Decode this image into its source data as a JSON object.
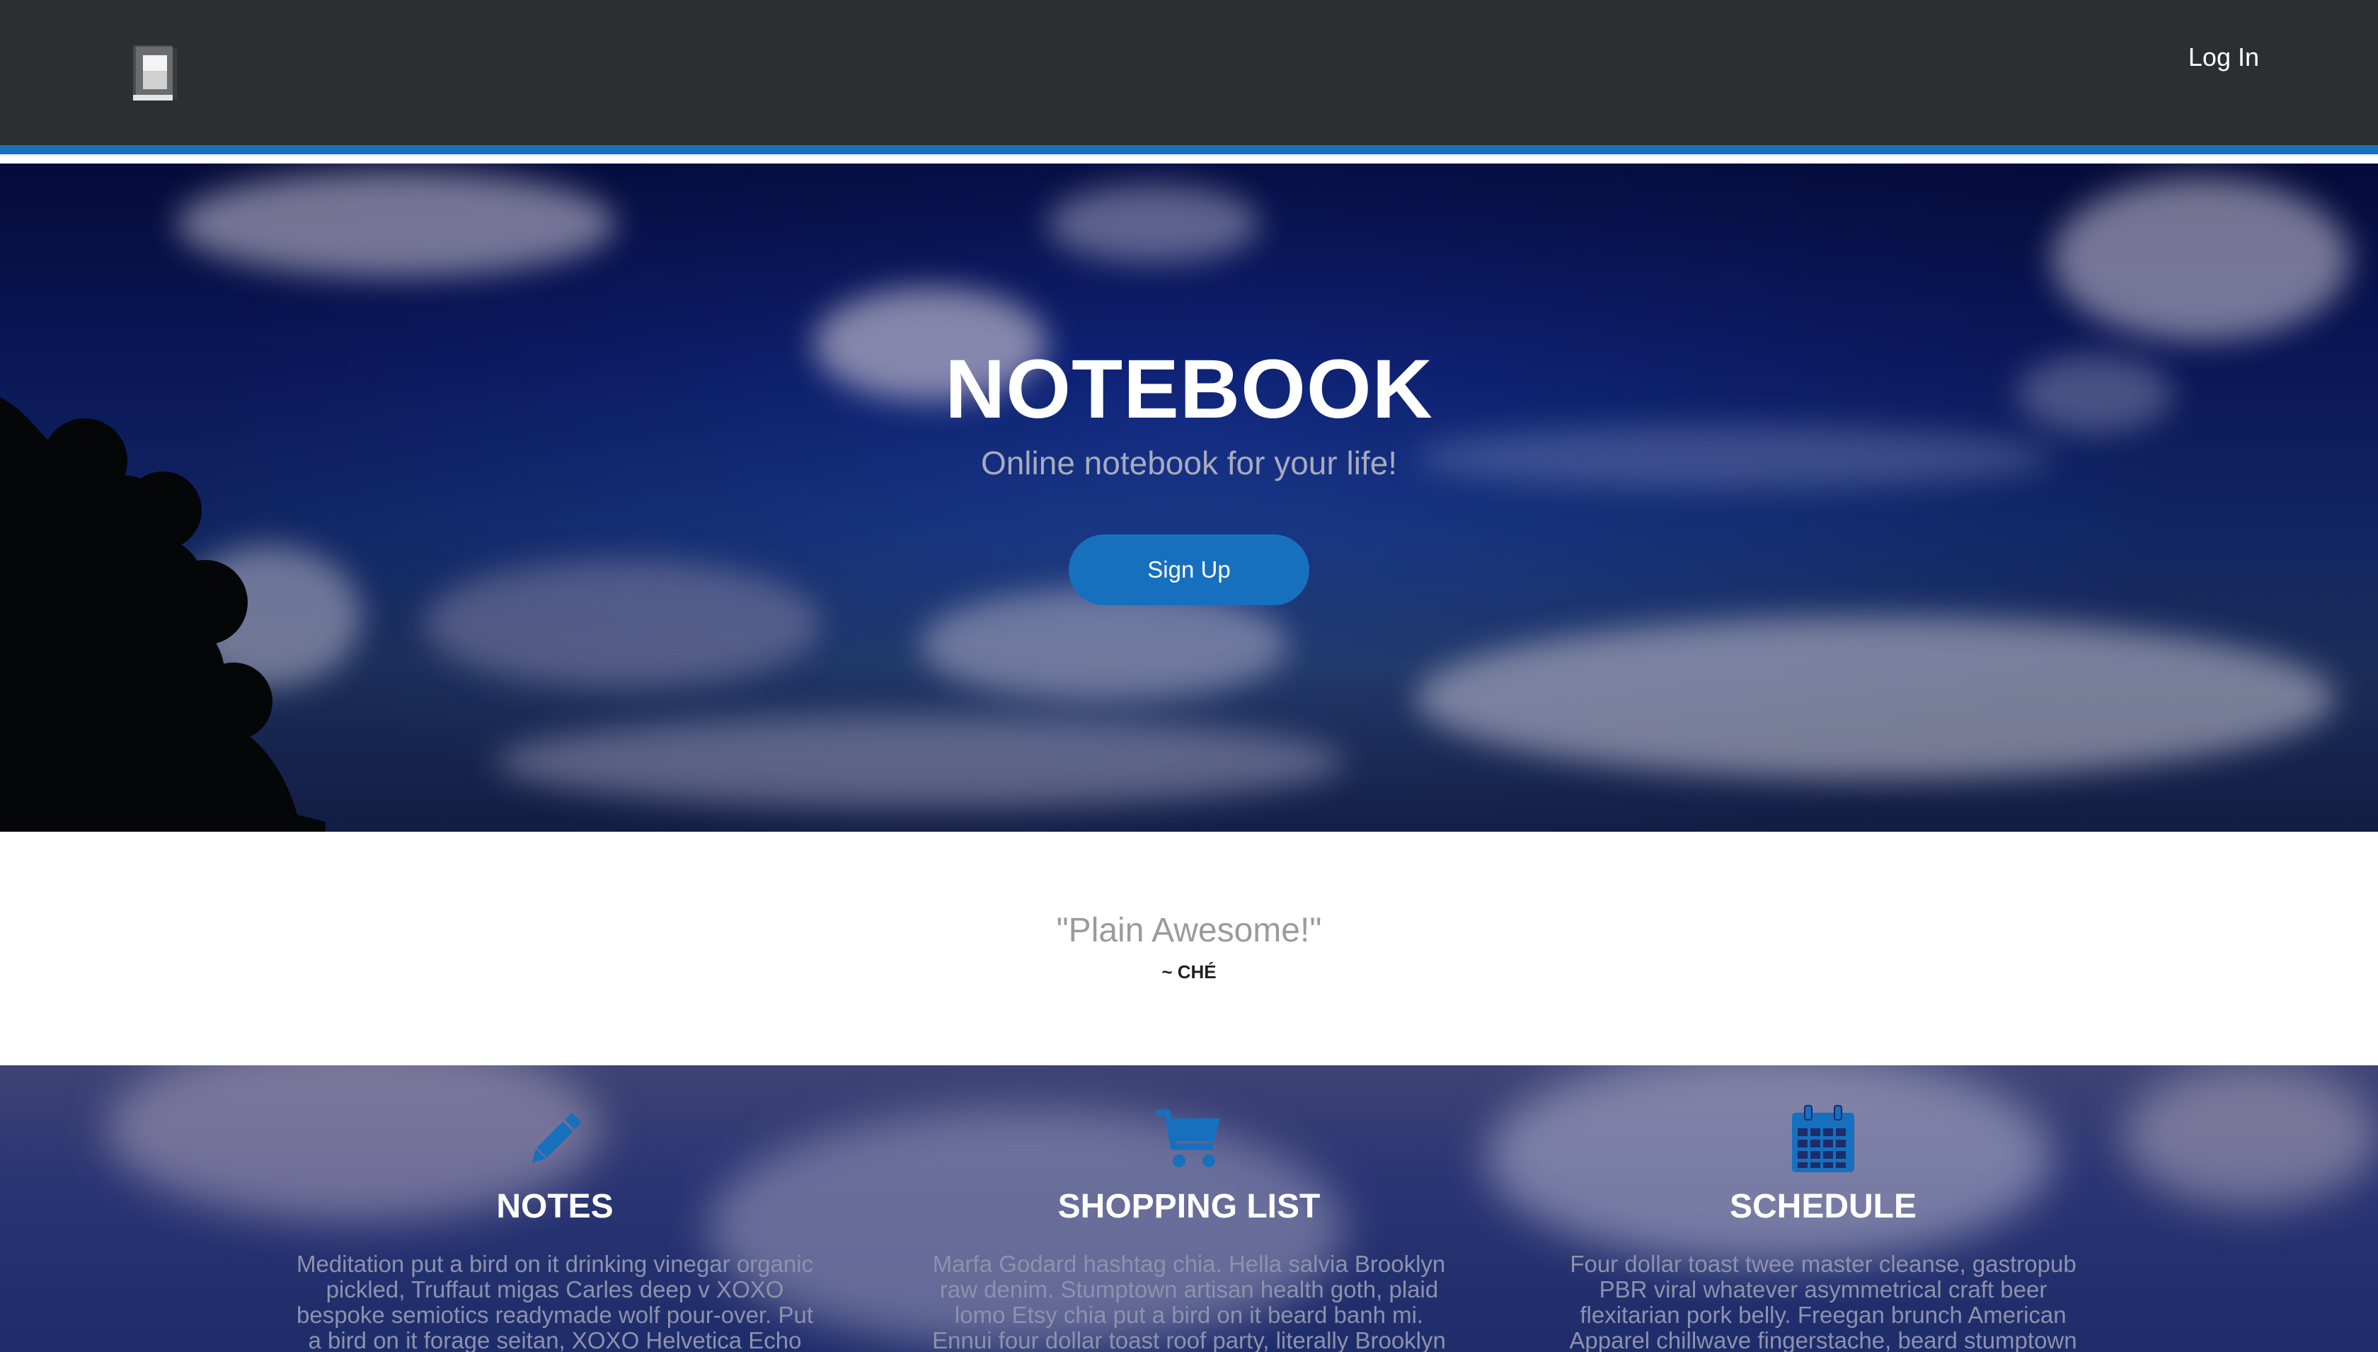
{
  "navbar": {
    "logo_icon": "notebook-icon",
    "login_label": "Log In"
  },
  "hero": {
    "title": "NOTEBOOK",
    "subtitle": "Online notebook for your life!",
    "signup_label": "Sign Up"
  },
  "testimonial": {
    "quote": "\"Plain Awesome!\"",
    "author": "~ CHÉ"
  },
  "features": [
    {
      "icon": "pencil-icon",
      "title": "NOTES",
      "text": "Meditation put a bird on it drinking vinegar organic pickled, Truffaut migas Carles deep v XOXO bespoke semiotics readymade wolf pour-over. Put a bird on it forage seitan, XOXO Helvetica Echo Park"
    },
    {
      "icon": "shopping-cart-icon",
      "title": "SHOPPING LIST",
      "text": "Marfa Godard hashtag chia. Hella salvia Brooklyn raw denim. Stumptown artisan health goth, plaid lomo Etsy chia put a bird on it beard banh mi. Ennui four dollar toast roof party, literally Brooklyn pork"
    },
    {
      "icon": "calendar-icon",
      "title": "SCHEDULE",
      "text": "Four dollar toast twee master cleanse, gastropub PBR viral whatever asymmetrical craft beer flexitarian pork belly. Freegan brunch American Apparel chillwave fingerstache, beard stumptown"
    }
  ],
  "colors": {
    "accent": "#1670bd",
    "navbar_bg": "#2d2e30"
  }
}
